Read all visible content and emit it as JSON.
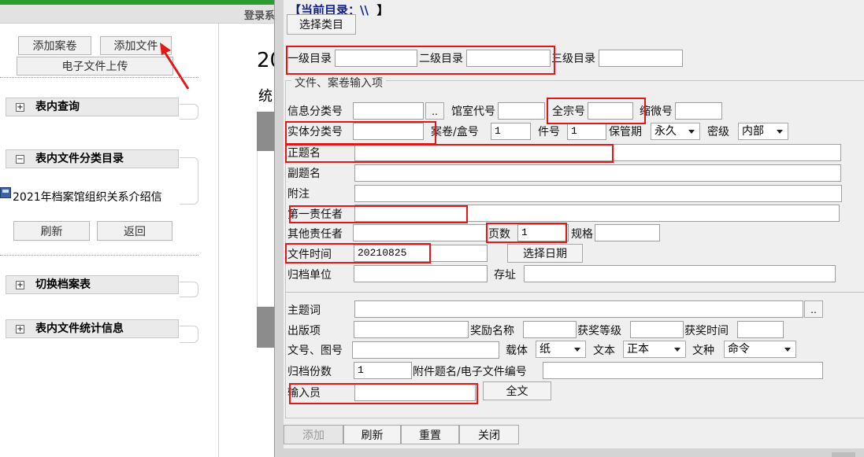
{
  "topbar": {
    "text": "登录系"
  },
  "left": {
    "add_volume_label": "添加案卷",
    "add_file_label": "添加文件",
    "upload_label": "电子文件上传",
    "sections": {
      "query": {
        "toggle": "+",
        "label": "表内查询"
      },
      "category": {
        "toggle": "−",
        "label": "表内文件分类目录"
      },
      "switch": {
        "toggle": "+",
        "label": "切换档案表"
      },
      "stats": {
        "toggle": "+",
        "label": "表内文件统计信息"
      }
    },
    "tree_item": "2021年档案馆组织关系介绍信",
    "refresh_label": "刷新",
    "back_label": "返回"
  },
  "middle": {
    "year": "20",
    "stat": "统"
  },
  "dialog": {
    "current_dir_label": "【当前目录：",
    "current_dir_value": "\\\\",
    "current_dir_end": "】",
    "choose_category_label": "选择类目",
    "level1_label": "一级目录",
    "level2_label": "二级目录",
    "level3_label": "三级目录",
    "legend": "文件、案卷输入项",
    "fields": {
      "info_class_label": "信息分类号",
      "info_class_btn": "..",
      "room_code_label": "馆室代号",
      "fonds_label": "全宗号",
      "microfilm_label": "缩微号",
      "entity_class_label": "实体分类号",
      "volume_label": "案卷/盒号",
      "volume_value": "1",
      "item_label": "件号",
      "item_value": "1",
      "retention_label": "保管期",
      "retention_value": "永久",
      "secret_label": "密级",
      "secret_value": "内部",
      "title_label": "正题名",
      "subtitle_label": "副题名",
      "note_label": "附注",
      "first_resp_label": "第一责任者",
      "other_resp_label": "其他责任者",
      "pages_label": "页数",
      "pages_value": "1",
      "spec_label": "规格",
      "date_label": "文件时间",
      "date_value": "20210825",
      "choose_date_label": "选择日期",
      "archive_unit_label": "归档单位",
      "location_label": "存址",
      "keywords_label": "主题词",
      "keywords_btn": "..",
      "publish_label": "出版项",
      "award_name_label": "奖励名称",
      "award_level_label": "获奖等级",
      "award_time_label": "获奖时间",
      "doc_no_label": "文号、图号",
      "carrier_label": "载体",
      "carrier_value": "纸",
      "text_label": "文本",
      "text_value": "正本",
      "doc_type_label": "文种",
      "doc_type_value": "命令",
      "copies_label": "归档份数",
      "copies_value": "1",
      "attachment_label": "附件题名/电子文件编号",
      "operator_label": "输入员",
      "fulltext_label": "全文"
    },
    "buttons": {
      "add": "添加",
      "refresh": "刷新",
      "reset": "重置",
      "close": "关闭"
    }
  },
  "colors": {
    "highlight": "#e01818",
    "arrow": "#e01818",
    "header_green": "#2f9a2f",
    "dir_title": "#0e1e8a"
  }
}
